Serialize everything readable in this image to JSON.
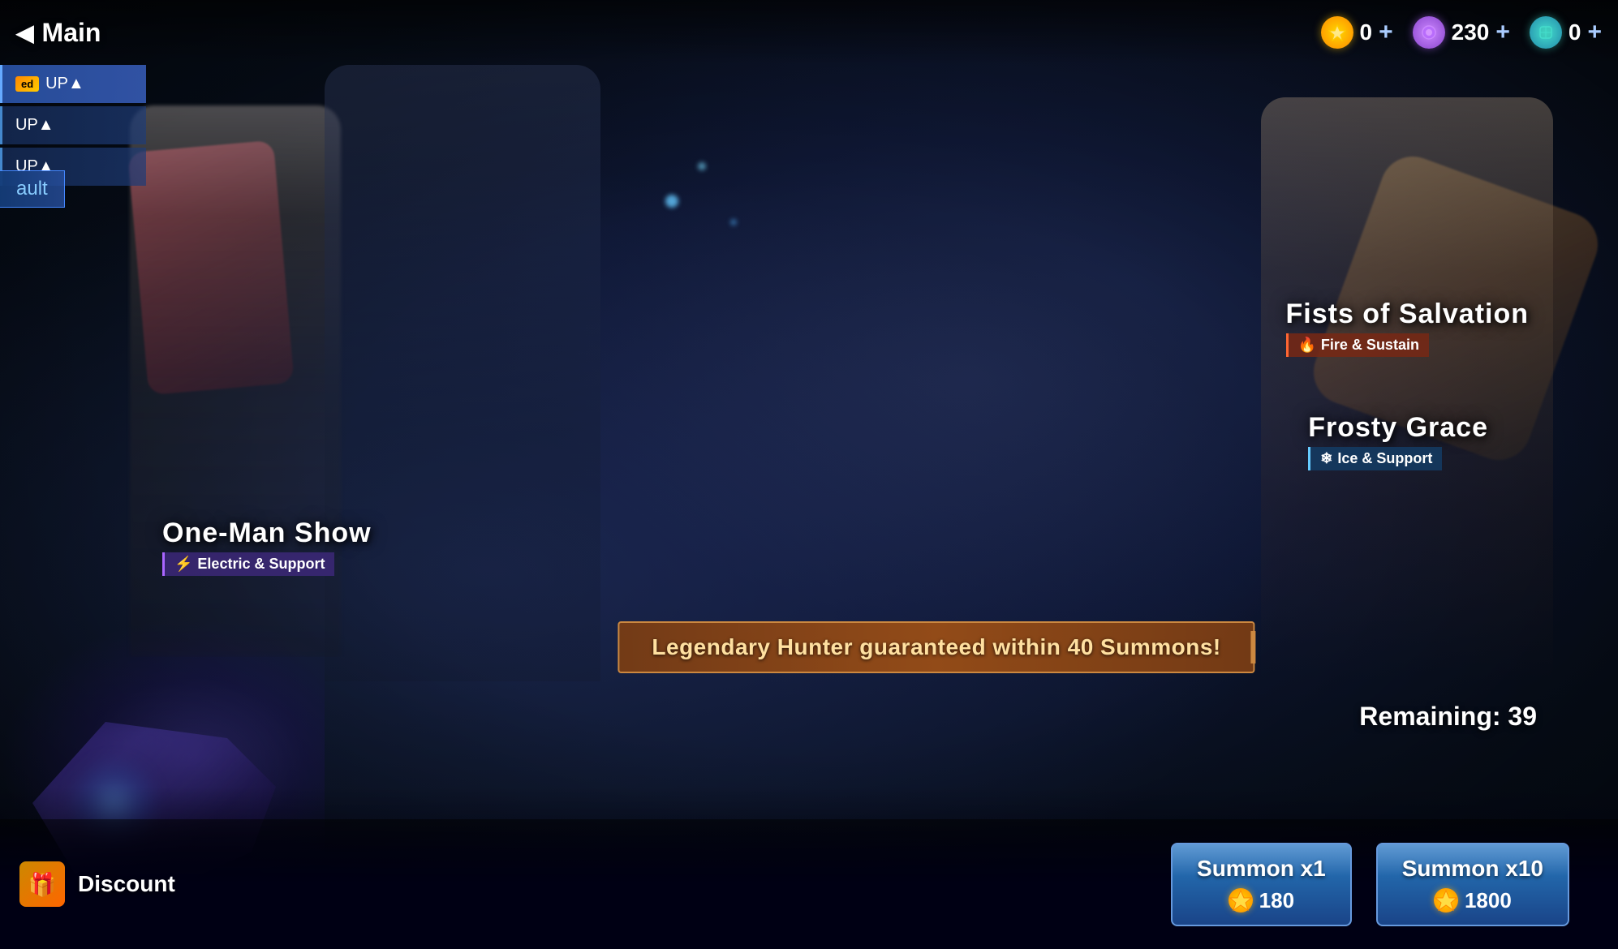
{
  "topbar": {
    "title": "Main",
    "currencies": [
      {
        "id": "gold",
        "amount": "0",
        "type": "gold"
      },
      {
        "id": "purple",
        "amount": "230",
        "type": "purple"
      },
      {
        "id": "teal",
        "amount": "0",
        "type": "teal"
      }
    ],
    "plus_label": "+"
  },
  "sidebar": {
    "vault_label": "ault",
    "items": [
      {
        "id": "item1",
        "label": "UP▲",
        "has_badge": true,
        "badge_text": "ed"
      },
      {
        "id": "item2",
        "label": "UP▲",
        "has_badge": false
      },
      {
        "id": "item3",
        "label": "UP▲",
        "has_badge": false
      }
    ]
  },
  "characters": [
    {
      "id": "one-man-show",
      "name": "One-Man Show",
      "type": "Electric & Support",
      "type_class": "electric",
      "type_icon": "⚡"
    },
    {
      "id": "frosty-grace",
      "name": "Frosty Grace",
      "type": "Ice & Support",
      "type_class": "ice",
      "type_icon": "❄"
    },
    {
      "id": "fists-of-salvation",
      "name": "Fists of Salvation",
      "type": "Fire & Sustain",
      "type_class": "fire",
      "type_icon": "🔥"
    }
  ],
  "guarantee": {
    "banner_text": "Legendary Hunter guaranteed within 40 Summons!",
    "remaining_label": "Remaining: 39"
  },
  "summon": {
    "x1_label": "Summon x1",
    "x1_cost": "180",
    "x10_label": "Summon x10",
    "x10_cost": "1800"
  },
  "discount": {
    "label": "Discount",
    "icon": "🎁"
  }
}
